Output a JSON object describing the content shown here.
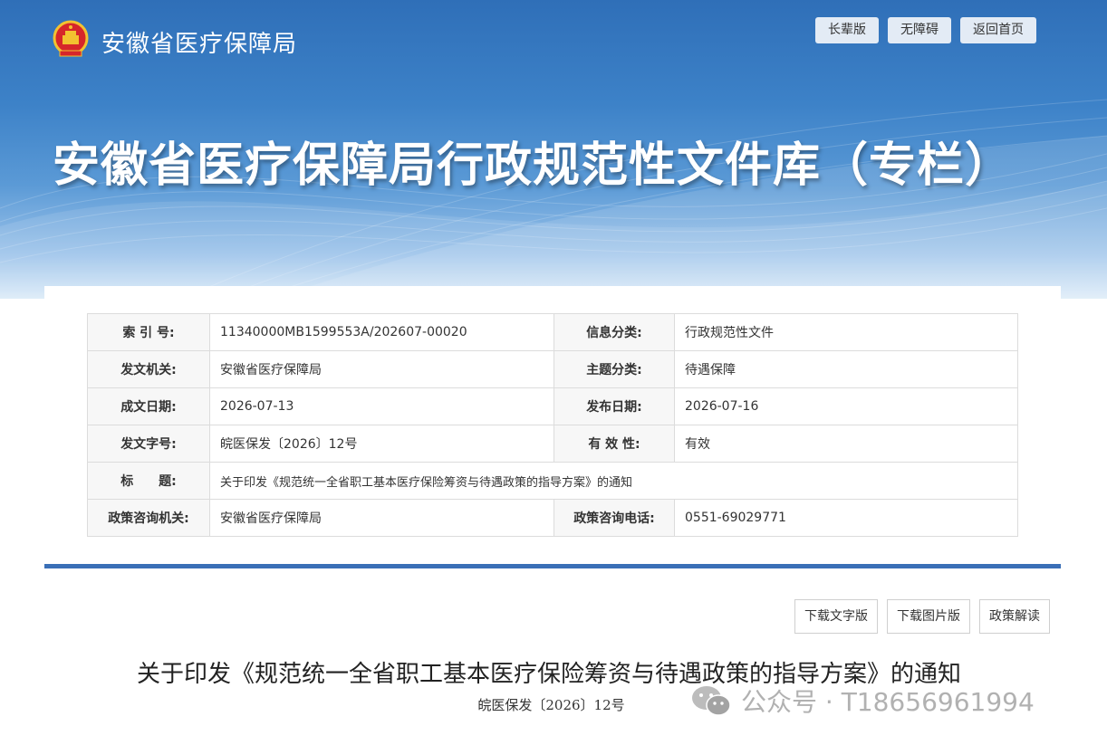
{
  "header": {
    "site_name": "安徽省医疗保障局",
    "buttons": [
      "长辈版",
      "无障碍",
      "返回首页"
    ],
    "banner_title": "安徽省医疗保障局行政规范性文件库（专栏）"
  },
  "meta": {
    "rows": [
      {
        "l1": "索 引 号:",
        "v1": "11340000MB1599553A/202607-00020",
        "l2": "信息分类:",
        "v2": "行政规范性文件"
      },
      {
        "l1": "发文机关:",
        "v1": "安徽省医疗保障局",
        "l2": "主题分类:",
        "v2": "待遇保障"
      },
      {
        "l1": "成文日期:",
        "v1": "2026-07-13",
        "l2": "发布日期:",
        "v2": "2026-07-16"
      },
      {
        "l1": "发文字号:",
        "v1": "皖医保发〔2026〕12号",
        "l2": "有 效 性:",
        "v2": "有效"
      },
      {
        "l1": "标　　题:",
        "v1": "关于印发《规范统一全省职工基本医疗保险筹资与待遇政策的指导方案》的通知"
      },
      {
        "l1": "政策咨询机关:",
        "v1": "安徽省医疗保障局",
        "l2": "政策咨询电话:",
        "v2": "0551-69029771"
      }
    ]
  },
  "actions": [
    "下载文字版",
    "下载图片版",
    "政策解读"
  ],
  "document": {
    "title": "关于印发《规范统一全省职工基本医疗保险筹资与待遇政策的指导方案》的通知",
    "number": "皖医保发〔2026〕12号"
  },
  "watermark": {
    "text": "公众号 · T18656961994",
    "icon": "wechat-icon"
  },
  "colors": {
    "banner": "#3d82c8",
    "accent": "#3a6fb7"
  }
}
